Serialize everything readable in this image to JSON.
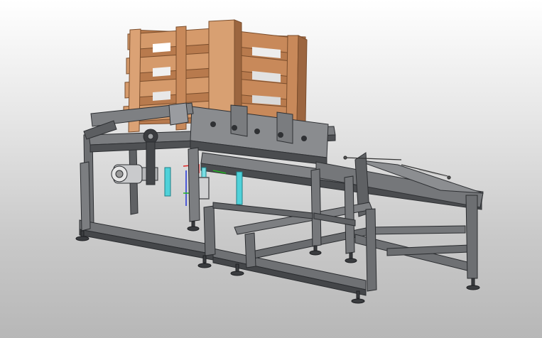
{
  "scene": {
    "subject": "conveyor-frame-with-pallet",
    "colors": {
      "frame": "#6d6f72",
      "frame_dark": "#3f4144",
      "frame_light": "#a3a5a8",
      "wood": "#c8895a",
      "wood_dark": "#9c6640",
      "wood_light": "#dba275",
      "cyan": "#4fd1d9",
      "axis_red": "#e02424",
      "axis_green": "#22b022",
      "axis_blue": "#2a3bd8"
    },
    "icons": [
      "pallet-crate",
      "steel-frame",
      "conveyor-deck",
      "motor",
      "leveling-foot",
      "cylinder",
      "axis-triad"
    ]
  }
}
